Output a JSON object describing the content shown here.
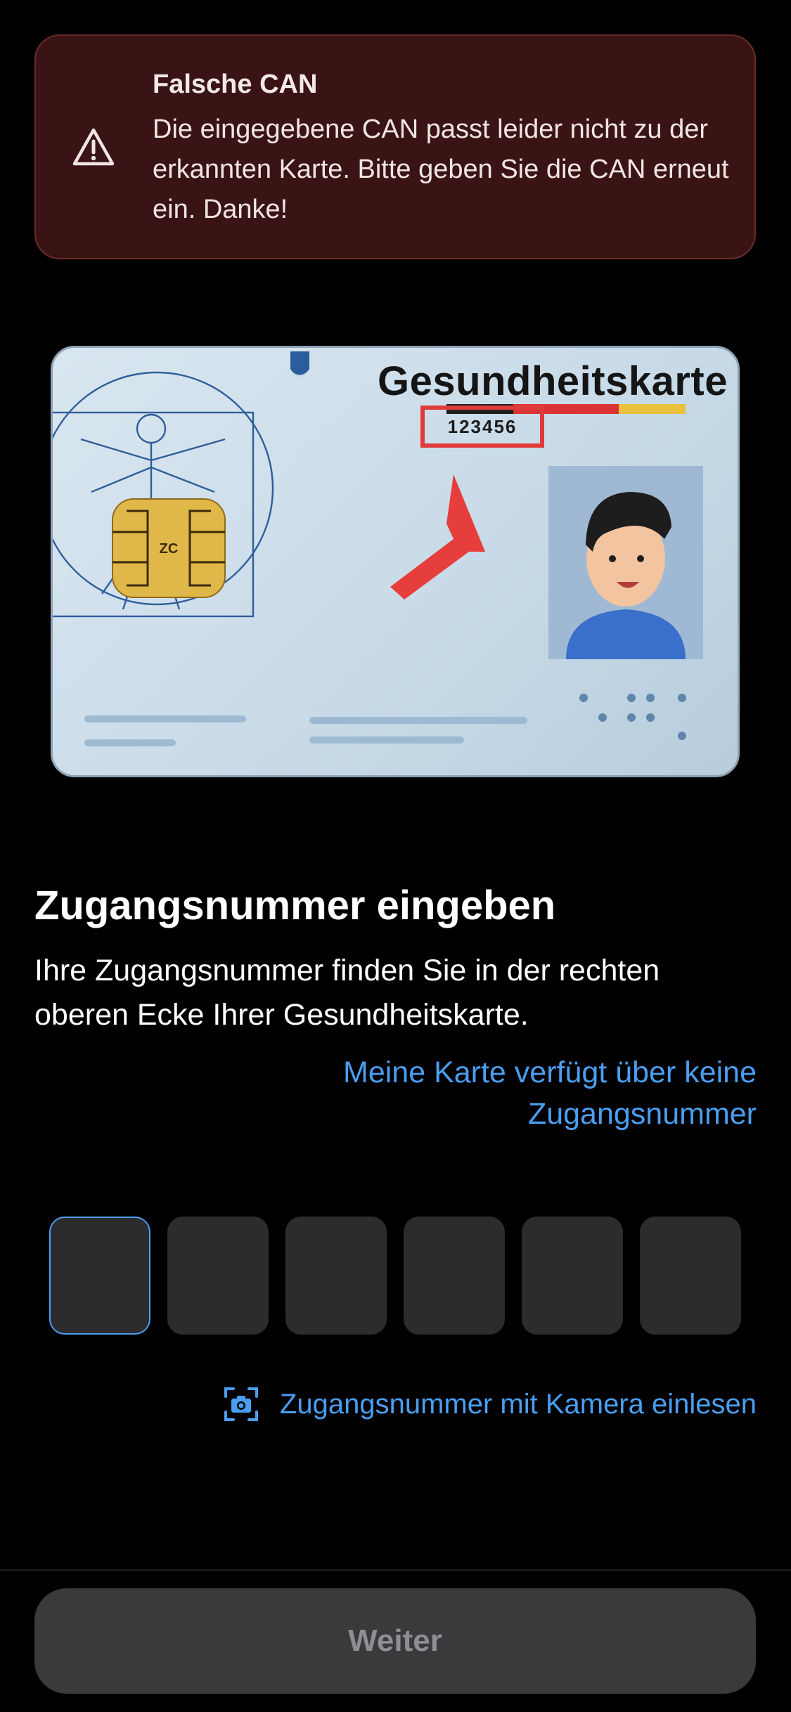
{
  "error_banner": {
    "title": "Falsche CAN",
    "message": "Die eingegebene CAN passt leider nicht zu der erkannten Karte. Bitte geben Sie die CAN erneut ein. Danke!",
    "icon": "warning-triangle-icon"
  },
  "card_illustration": {
    "title": "Gesundheitskarte",
    "can_example": "123456"
  },
  "main": {
    "title": "Zugangsnummer eingeben",
    "description": "Ihre Zugangsnummer finden Sie in der rechten oberen Ecke Ihrer Gesundheitskarte.",
    "no_can_link": "Meine Karte verfügt über keine Zugangsnummer"
  },
  "can_input": {
    "digits": [
      "",
      "",
      "",
      "",
      "",
      ""
    ],
    "active_index": 0
  },
  "camera_link": {
    "label": "Zugangsnummer mit Kamera einlesen",
    "icon": "camera-scan-icon"
  },
  "footer": {
    "continue_label": "Weiter"
  },
  "colors": {
    "accent": "#4a9ef0",
    "error_background": "#3a1414",
    "input_background": "#2c2c2e",
    "disabled_button": "#3a3a3c"
  }
}
